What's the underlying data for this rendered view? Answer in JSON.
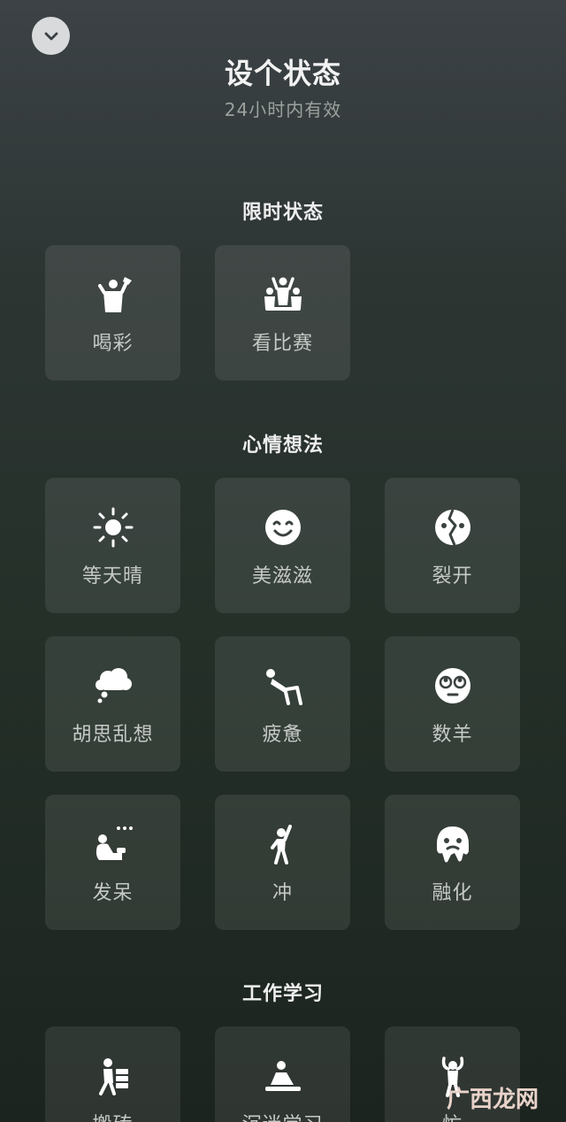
{
  "header": {
    "title": "设个状态",
    "subtitle": "24小时内有效"
  },
  "sections": [
    {
      "title": "限时状态",
      "items": [
        {
          "label": "喝彩",
          "icon": "cheer-icon"
        },
        {
          "label": "看比赛",
          "icon": "watch-game-icon"
        }
      ]
    },
    {
      "title": "心情想法",
      "items": [
        {
          "label": "等天晴",
          "icon": "sun-icon"
        },
        {
          "label": "美滋滋",
          "icon": "smile-icon"
        },
        {
          "label": "裂开",
          "icon": "broken-face-icon"
        },
        {
          "label": "胡思乱想",
          "icon": "thought-cloud-icon"
        },
        {
          "label": "疲惫",
          "icon": "tired-icon"
        },
        {
          "label": "数羊",
          "icon": "counting-sheep-icon"
        },
        {
          "label": "发呆",
          "icon": "daze-icon"
        },
        {
          "label": "冲",
          "icon": "charge-icon"
        },
        {
          "label": "融化",
          "icon": "melting-icon"
        }
      ]
    },
    {
      "title": "工作学习",
      "items": [
        {
          "label": "搬砖",
          "icon": "moving-bricks-icon"
        },
        {
          "label": "沉迷学习",
          "icon": "studying-icon"
        },
        {
          "label": "忙",
          "icon": "busy-icon"
        }
      ]
    }
  ],
  "watermark": "广西龙网"
}
